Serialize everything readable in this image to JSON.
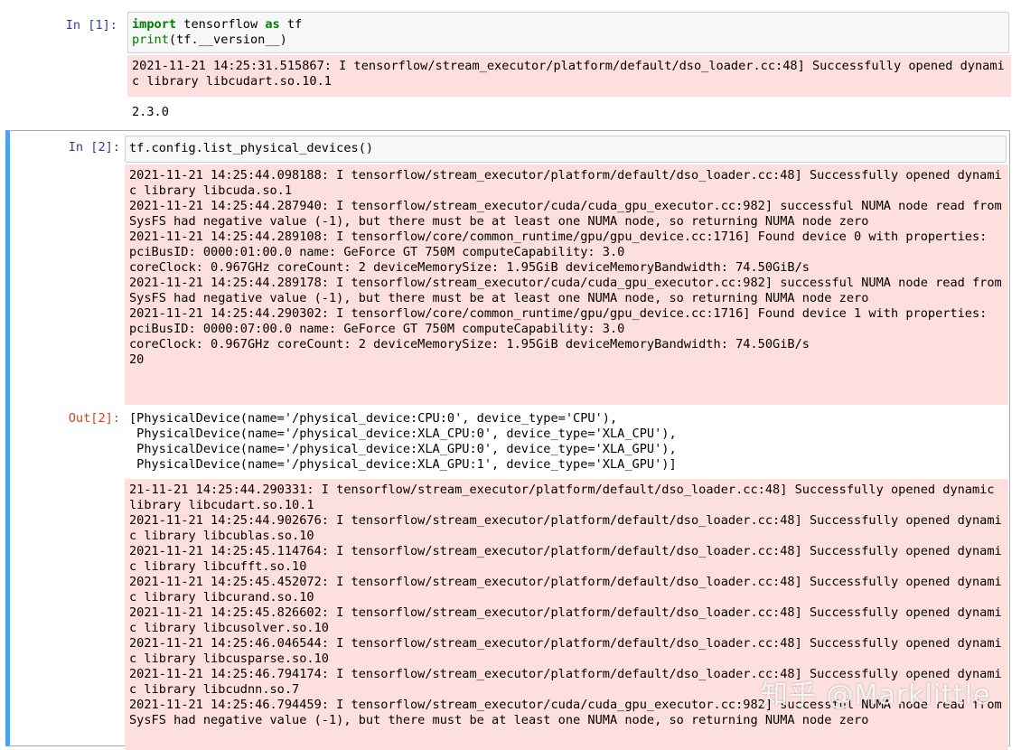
{
  "cells": [
    {
      "prompt": "In [1]:",
      "code_line1": {
        "kw_import": "import",
        "mod": " tensorflow ",
        "kw_as": "as",
        "alias": " tf"
      },
      "code_line2": {
        "fn": "print",
        "rest": "(tf.__version__)"
      },
      "stderr": "2021-11-21 14:25:31.515867: I tensorflow/stream_executor/platform/default/dso_loader.cc:48] Successfully opened dynamic library libcudart.so.10.1",
      "stdout": "2.3.0"
    },
    {
      "prompt": "In [2]:",
      "code": "tf.config.list_physical_devices()",
      "stderr": "2021-11-21 14:25:44.098188: I tensorflow/stream_executor/platform/default/dso_loader.cc:48] Successfully opened dynamic library libcuda.so.1\n2021-11-21 14:25:44.287940: I tensorflow/stream_executor/cuda/cuda_gpu_executor.cc:982] successful NUMA node read from SysFS had negative value (-1), but there must be at least one NUMA node, so returning NUMA node zero\n2021-11-21 14:25:44.289108: I tensorflow/core/common_runtime/gpu/gpu_device.cc:1716] Found device 0 with properties: \npciBusID: 0000:01:00.0 name: GeForce GT 750M computeCapability: 3.0\ncoreClock: 0.967GHz coreCount: 2 deviceMemorySize: 1.95GiB deviceMemoryBandwidth: 74.50GiB/s\n2021-11-21 14:25:44.289178: I tensorflow/stream_executor/cuda/cuda_gpu_executor.cc:982] successful NUMA node read from SysFS had negative value (-1), but there must be at least one NUMA node, so returning NUMA node zero\n2021-11-21 14:25:44.290302: I tensorflow/core/common_runtime/gpu/gpu_device.cc:1716] Found device 1 with properties: \npciBusID: 0000:07:00.0 name: GeForce GT 750M computeCapability: 3.0\ncoreClock: 0.967GHz coreCount: 2 deviceMemorySize: 1.95GiB deviceMemoryBandwidth: 74.50GiB/s\n20",
      "out_prompt": "Out[2]:",
      "out": "[PhysicalDevice(name='/physical_device:CPU:0', device_type='CPU'),\n PhysicalDevice(name='/physical_device:XLA_CPU:0', device_type='XLA_CPU'),\n PhysicalDevice(name='/physical_device:XLA_GPU:0', device_type='XLA_GPU'),\n PhysicalDevice(name='/physical_device:XLA_GPU:1', device_type='XLA_GPU')]",
      "stderr2": "21-11-21 14:25:44.290331: I tensorflow/stream_executor/platform/default/dso_loader.cc:48] Successfully opened dynamic library libcudart.so.10.1\n2021-11-21 14:25:44.902676: I tensorflow/stream_executor/platform/default/dso_loader.cc:48] Successfully opened dynamic library libcublas.so.10\n2021-11-21 14:25:45.114764: I tensorflow/stream_executor/platform/default/dso_loader.cc:48] Successfully opened dynamic library libcufft.so.10\n2021-11-21 14:25:45.452072: I tensorflow/stream_executor/platform/default/dso_loader.cc:48] Successfully opened dynamic library libcurand.so.10\n2021-11-21 14:25:45.826602: I tensorflow/stream_executor/platform/default/dso_loader.cc:48] Successfully opened dynamic library libcusolver.so.10\n2021-11-21 14:25:46.046544: I tensorflow/stream_executor/platform/default/dso_loader.cc:48] Successfully opened dynamic library libcusparse.so.10\n2021-11-21 14:25:46.794174: I tensorflow/stream_executor/platform/default/dso_loader.cc:48] Successfully opened dynamic library libcudnn.so.7\n2021-11-21 14:25:46.794459: I tensorflow/stream_executor/cuda/cuda_gpu_executor.cc:982] successful NUMA node read from SysFS had negative value (-1), but there must be at least one NUMA node, so returning NUMA node zero"
    }
  ],
  "watermark": "知乎 @Marklittle",
  "colors": {
    "prompt_in": "#303f9f",
    "prompt_out": "#d84315",
    "stderr_bg": "#fddfdd",
    "selected_border": "#42a5f5"
  }
}
